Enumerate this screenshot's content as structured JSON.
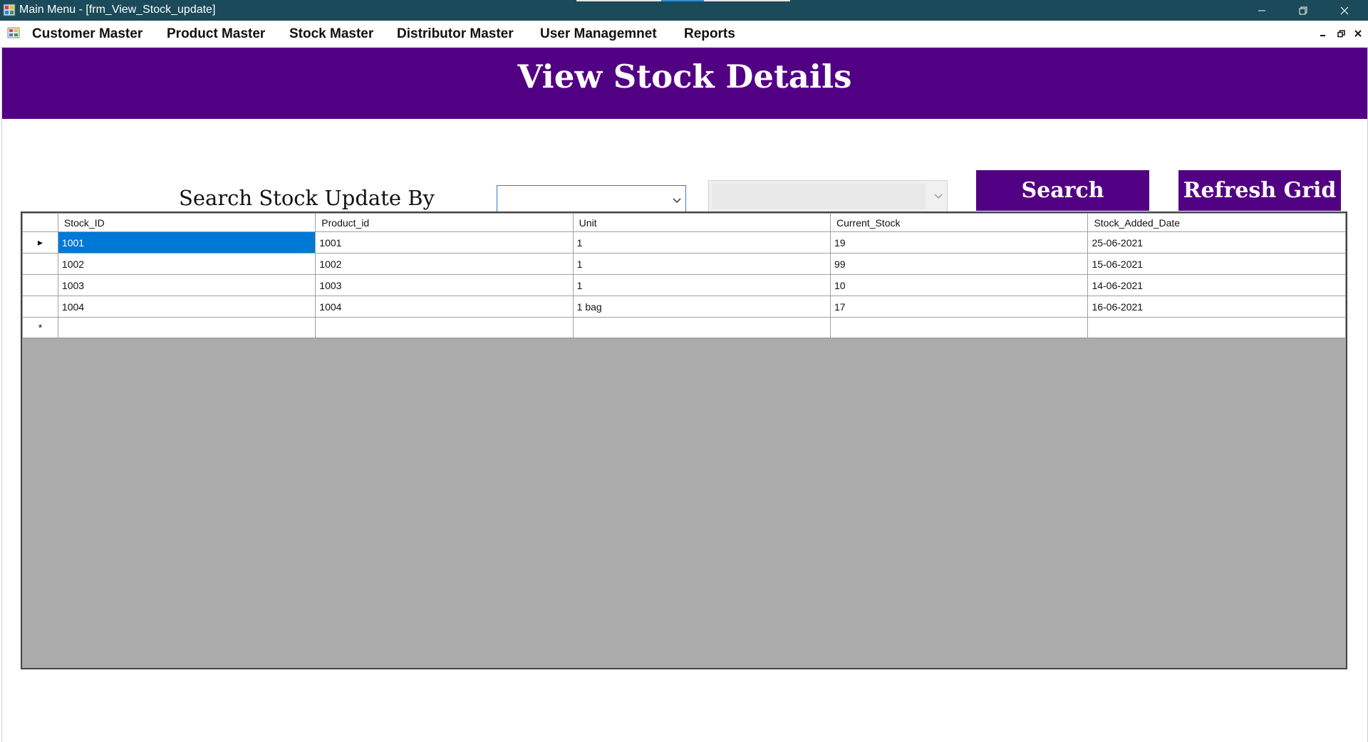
{
  "window": {
    "title": "Main Menu - [frm_View_Stock_update]"
  },
  "menu": {
    "items": [
      {
        "label": "Customer Master"
      },
      {
        "label": "Product Master"
      },
      {
        "label": "Stock Master"
      },
      {
        "label": "Distributor Master"
      },
      {
        "label": "User Managemnet"
      },
      {
        "label": "Reports"
      }
    ]
  },
  "page": {
    "title": "View Stock Details",
    "search_label": "Search Stock Update By",
    "search_by_value": "",
    "search_value": "",
    "search_button": "Search",
    "refresh_button": "Refresh Grid"
  },
  "grid": {
    "columns": [
      "Stock_ID",
      "Product_id",
      "Unit",
      "Current_Stock",
      "Stock_Added_Date"
    ],
    "rows": [
      [
        "1001",
        "1001",
        "1",
        "19",
        "25-06-2021"
      ],
      [
        "1002",
        "1002",
        "1",
        "99",
        "15-06-2021"
      ],
      [
        "1003",
        "1003",
        "1",
        "10",
        "14-06-2021"
      ],
      [
        "1004",
        "1004",
        "1 bag",
        "17",
        "16-06-2021"
      ]
    ],
    "current_row_marker": "▸",
    "new_row_marker": "*"
  },
  "colors": {
    "accent": "#520083",
    "titlebar": "#1b4a5a",
    "selection": "#0078d7",
    "grid_background": "#ababab"
  }
}
